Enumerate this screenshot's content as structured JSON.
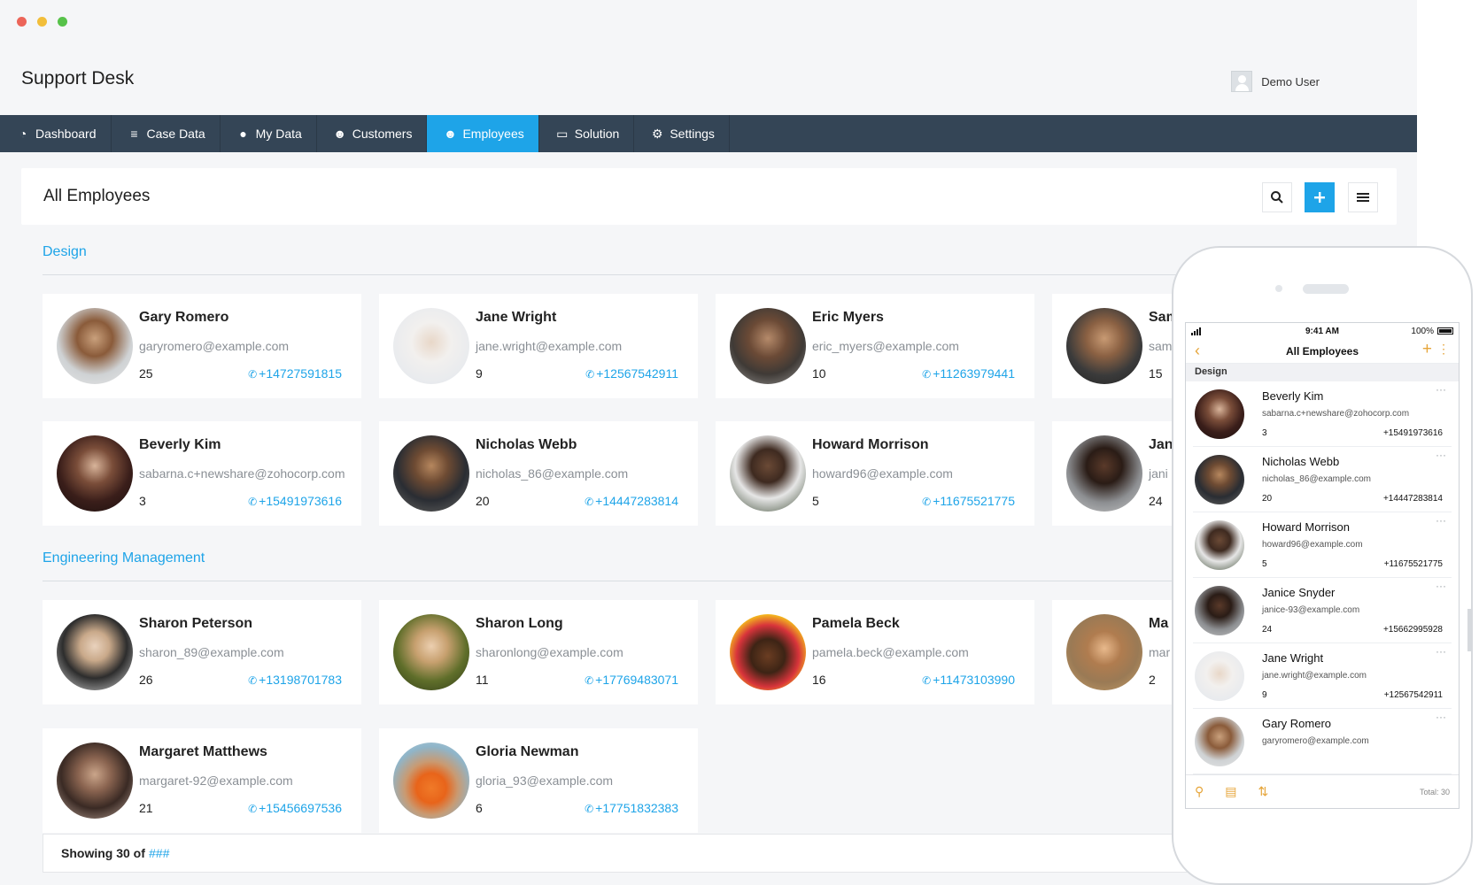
{
  "window": {
    "app_title": "Support Desk",
    "user_name": "Demo User"
  },
  "nav": [
    {
      "label": "Dashboard",
      "icon": "dashboard-icon",
      "glyph": "◔",
      "active": false
    },
    {
      "label": "Case Data",
      "icon": "database-icon",
      "glyph": "≡",
      "active": false
    },
    {
      "label": "My Data",
      "icon": "user-icon",
      "glyph": "●",
      "active": false
    },
    {
      "label": "Customers",
      "icon": "group-icon",
      "glyph": "☻",
      "active": false
    },
    {
      "label": "Employees",
      "icon": "employees-icon",
      "glyph": "☻",
      "active": true
    },
    {
      "label": "Solution",
      "icon": "solution-icon",
      "glyph": "▭",
      "active": false
    },
    {
      "label": "Settings",
      "icon": "gear-icon",
      "glyph": "⚙",
      "active": false
    }
  ],
  "panel": {
    "title": "All Employees",
    "tools": [
      "search-icon",
      "plus-icon",
      "menu-icon"
    ]
  },
  "colors": {
    "accent": "#1ea4e8",
    "navbar": "#344556",
    "mobile_accent": "#e6a53a"
  },
  "sections": [
    {
      "title": "Design",
      "cards": [
        {
          "name": "Gary Romero",
          "email": "garyromero@example.com",
          "age": "25",
          "phone": "+14727591815"
        },
        {
          "name": "Jane Wright",
          "email": "jane.wright@example.com",
          "age": "9",
          "phone": "+12567542911"
        },
        {
          "name": "Eric Myers",
          "email": "eric_myers@example.com",
          "age": "10",
          "phone": "+11263979441"
        },
        {
          "name": "Sam",
          "email": "sam",
          "age": "15",
          "phone": ""
        },
        {
          "name": "Beverly Kim",
          "email": "sabarna.c+newshare@zohocorp.com",
          "age": "3",
          "phone": "+15491973616"
        },
        {
          "name": "Nicholas Webb",
          "email": "nicholas_86@example.com",
          "age": "20",
          "phone": "+14447283814"
        },
        {
          "name": "Howard Morrison",
          "email": "howard96@example.com",
          "age": "5",
          "phone": "+11675521775"
        },
        {
          "name": "Jan",
          "email": "jani",
          "age": "24",
          "phone": ""
        }
      ]
    },
    {
      "title": "Engineering Management",
      "cards": [
        {
          "name": "Sharon Peterson",
          "email": "sharon_89@example.com",
          "age": "26",
          "phone": "+13198701783"
        },
        {
          "name": "Sharon Long",
          "email": "sharonlong@example.com",
          "age": "11",
          "phone": "+17769483071"
        },
        {
          "name": "Pamela Beck",
          "email": "pamela.beck@example.com",
          "age": "16",
          "phone": "+11473103990"
        },
        {
          "name": "Ma",
          "email": "mar",
          "age": "2",
          "phone": ""
        },
        {
          "name": "Margaret Matthews",
          "email": "margaret-92@example.com",
          "age": "21",
          "phone": "+15456697536"
        },
        {
          "name": "Gloria Newman",
          "email": "gloria_93@example.com",
          "age": "6",
          "phone": "+17751832383"
        }
      ]
    }
  ],
  "footer": {
    "prefix": "Showing 30 of",
    "value": "###"
  },
  "mobile": {
    "status_time": "9:41 AM",
    "battery": "100%",
    "title": "All Employees",
    "group": "Design",
    "rows": [
      {
        "name": "Beverly Kim",
        "email": "sabarna.c+newshare@zohocorp.com",
        "age": "3",
        "phone": "+15491973616"
      },
      {
        "name": "Nicholas Webb",
        "email": "nicholas_86@example.com",
        "age": "20",
        "phone": "+14447283814"
      },
      {
        "name": "Howard Morrison",
        "email": "howard96@example.com",
        "age": "5",
        "phone": "+11675521775"
      },
      {
        "name": "Janice Snyder",
        "email": "janice-93@example.com",
        "age": "24",
        "phone": "+15662995928"
      },
      {
        "name": "Jane Wright",
        "email": "jane.wright@example.com",
        "age": "9",
        "phone": "+12567542911"
      },
      {
        "name": "Gary Romero",
        "email": "garyromero@example.com",
        "age": "",
        "phone": ""
      }
    ],
    "total": "Total: 30"
  }
}
